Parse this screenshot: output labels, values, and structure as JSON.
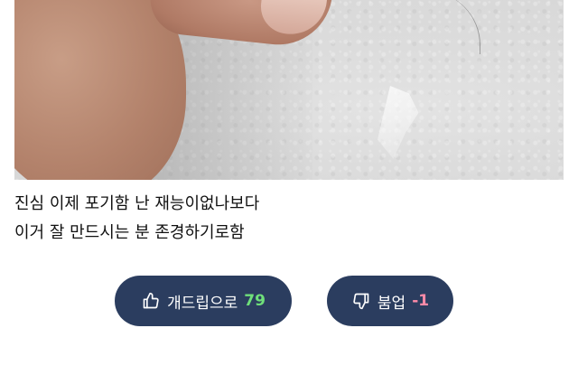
{
  "post": {
    "lines": [
      "진심 이제 포기함 난 재능이없나보다",
      "이거 잘 만드시는 분 존경하기로함"
    ]
  },
  "votes": {
    "up": {
      "label": "개드립으로",
      "count": "79",
      "icon": "thumbs-up-icon",
      "count_color": "#6fe07a"
    },
    "down": {
      "label": "붐업",
      "count": "-1",
      "icon": "thumbs-down-icon",
      "count_color": "#ff8ba8"
    },
    "button_color": "#2b3d5f"
  }
}
